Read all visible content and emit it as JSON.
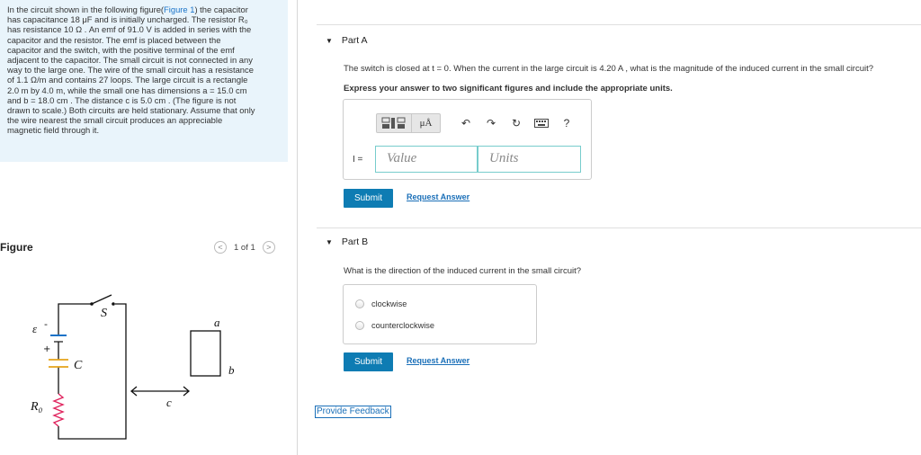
{
  "problem": {
    "lines": [
      [
        "In the circuit shown in the following figure(",
        "Figure 1",
        ") the capacitor"
      ],
      [
        "has capacitance 18 μF and is initially uncharged. The resistor R₀"
      ],
      [
        "has resistance 10 Ω . An emf of 91.0 V is added in series with the"
      ],
      [
        "capacitor and the resistor. The emf is placed between the"
      ],
      [
        "capacitor and the switch, with the positive terminal of the emf"
      ],
      [
        "adjacent to the capacitor. The small circuit is not connected in any"
      ],
      [
        "way to the large one. The wire of the small circuit has a resistance"
      ],
      [
        "of 1.1 Ω/m and contains 27 loops. The large circuit is a rectangle"
      ],
      [
        "2.0 m by 4.0 m, while the small one has dimensions a = 15.0 cm"
      ],
      [
        "and b = 18.0 cm . The distance c is 5.0 cm . (The figure is not"
      ],
      [
        "drawn to scale.) Both circuits are held stationary. Assume that only"
      ],
      [
        "the wire nearest the small circuit produces an appreciable"
      ],
      [
        "magnetic field through it."
      ]
    ]
  },
  "figure": {
    "title": "Figure",
    "pager_prev": "<",
    "pager_count": "1 of 1",
    "pager_next": ">",
    "labels": {
      "switch": "S",
      "emf": "ε",
      "minus": "-",
      "plus": "+",
      "capacitor": "C",
      "resistor": "R₀",
      "a": "a",
      "b": "b",
      "c": "c"
    }
  },
  "partA": {
    "title": "Part A",
    "question": "The switch is closed at t = 0. When the current in the large circuit is 4.20 A , what is the magnitude of the induced current in the small circuit?",
    "instructions": "Express your answer to two significant figures and include the appropriate units.",
    "toolbar": {
      "units_btn": "μÅ",
      "help": "?"
    },
    "input_label": "I =",
    "value_placeholder": "Value",
    "units_placeholder": "Units",
    "submit": "Submit",
    "request_answer": "Request Answer"
  },
  "partB": {
    "title": "Part B",
    "question": "What is the direction of the induced current in the small circuit?",
    "options": [
      "clockwise",
      "counterclockwise"
    ],
    "submit": "Submit",
    "request_answer": "Request Answer"
  },
  "feedback": "Provide Feedback"
}
